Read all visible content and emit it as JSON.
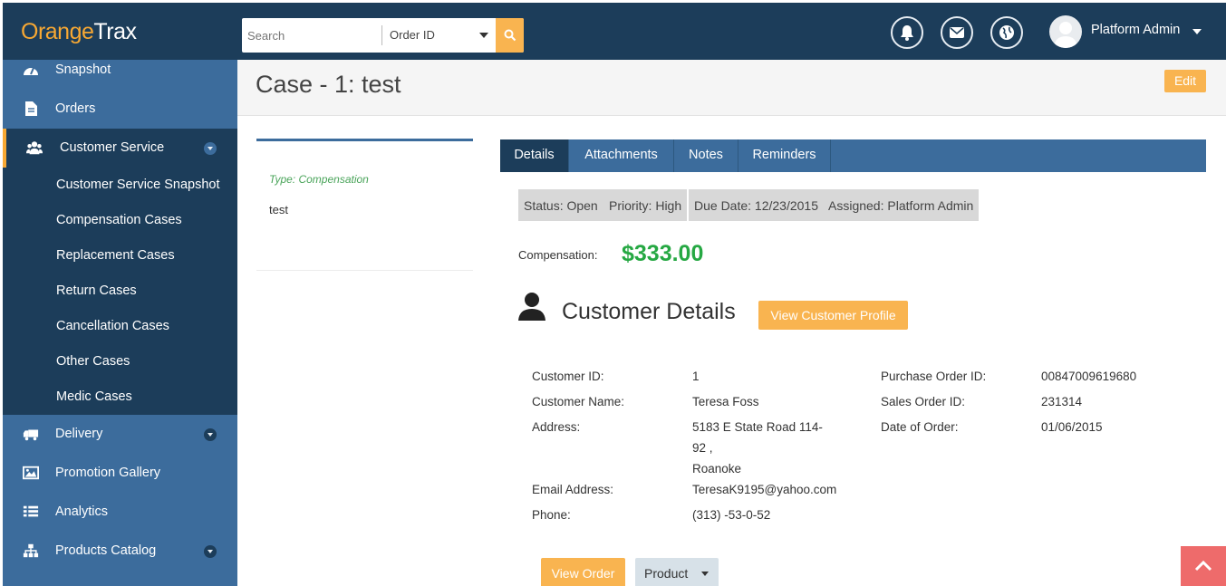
{
  "app": {
    "logo_prefix": "O",
    "logo_orange": "range",
    "logo_trax": "Trax"
  },
  "search": {
    "placeholder": "Search",
    "type_select": "Order ID"
  },
  "user": {
    "name": "Platform Admin"
  },
  "sidebar": {
    "items": [
      {
        "label": "Snapshot",
        "icon": "dashboard-icon"
      },
      {
        "label": "Orders",
        "icon": "document-icon"
      },
      {
        "label": "Customer Service",
        "icon": "users-icon"
      },
      {
        "label": "Delivery",
        "icon": "truck-icon"
      },
      {
        "label": "Promotion Gallery",
        "icon": "image-icon"
      },
      {
        "label": "Analytics",
        "icon": "list-icon"
      },
      {
        "label": "Products Catalog",
        "icon": "sitemap-icon"
      }
    ],
    "submenu": [
      "Customer Service Snapshot",
      "Compensation Cases",
      "Replacement Cases",
      "Return Cases",
      "Cancellation Cases",
      "Other Cases",
      "Medic Cases"
    ]
  },
  "page": {
    "title": "Case - 1: test",
    "edit_label": "Edit"
  },
  "case_summary": {
    "type": "Type: Compensation",
    "description": "test"
  },
  "tabs": [
    "Details",
    "Attachments",
    "Notes",
    "Reminders"
  ],
  "chips": [
    "Status: Open",
    "Priority: High",
    "Due Date: 12/23/2015",
    "Assigned: Platform Admin"
  ],
  "compensation": {
    "label": "Compensation:",
    "value": "$333.00"
  },
  "customer": {
    "heading": "Customer Details",
    "view_profile_label": "View Customer Profile",
    "fields": {
      "customer_id_label": "Customer ID:",
      "customer_id": "1",
      "customer_name_label": "Customer Name:",
      "customer_name": "Teresa Foss",
      "address_label": "Address:",
      "address_line1": "5183 E State Road 114-",
      "address_line2": "92 ,",
      "address_line3": "Roanoke",
      "email_label": "Email Address:",
      "email": "TeresaK9195@yahoo.com",
      "phone_label": "Phone:",
      "phone": "(313) -53-0-52",
      "po_label": "Purchase Order ID:",
      "po": "00847009619680",
      "so_label": "Sales Order ID:",
      "so": "231314",
      "date_label": "Date of Order:",
      "date": "01/06/2015"
    }
  },
  "actions": {
    "view_order": "View Order",
    "product": "Product"
  },
  "colors": {
    "navy": "#1c3d5a",
    "sidebar_blue": "#3c6c9c",
    "accent_orange": "#f9b450",
    "money_green": "#26a843",
    "scroll_red": "#ee6b6b"
  }
}
